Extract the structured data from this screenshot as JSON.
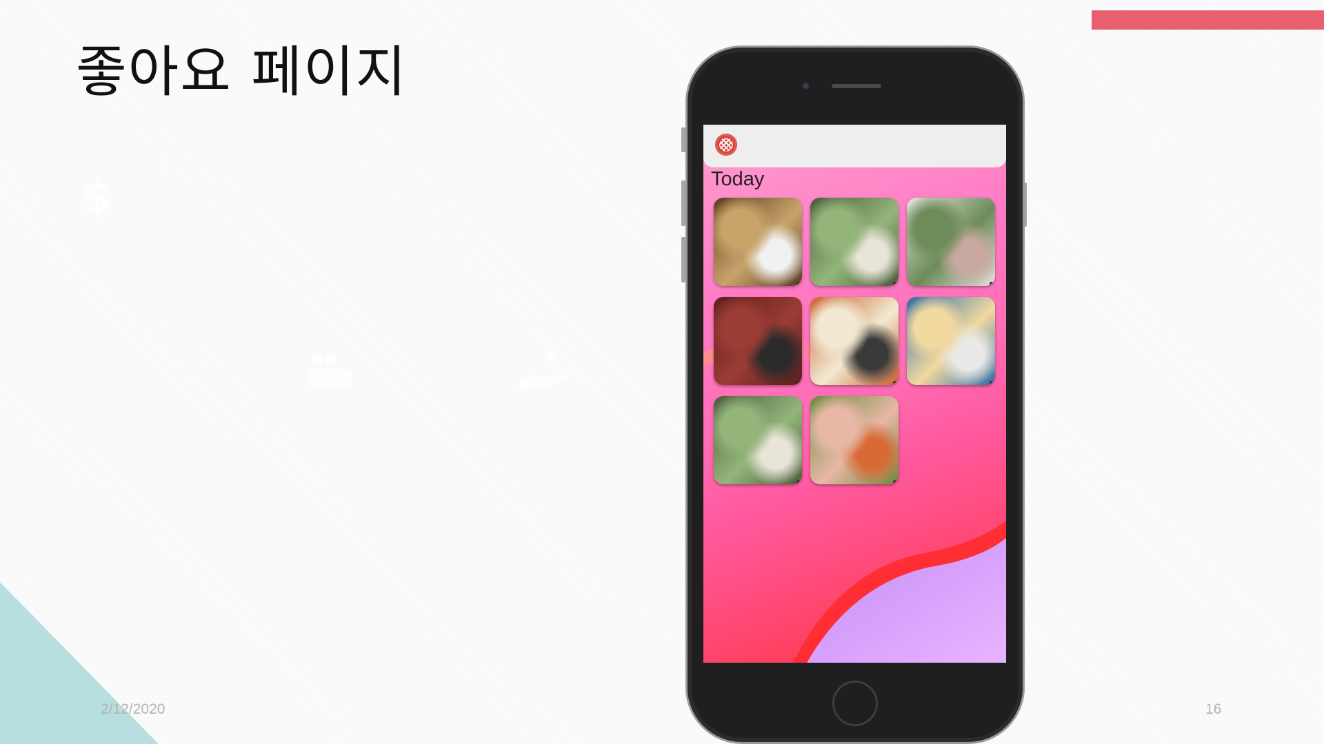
{
  "slide": {
    "title": "좋아요 페이지",
    "date": "2/12/2020",
    "page_number": "16"
  },
  "colors": {
    "accent": "#e8606f",
    "corner": "#b8dfe0"
  },
  "icons": [
    "dollar-icon",
    "people-icon",
    "hand-care-icon",
    "app-logo-icon"
  ],
  "app": {
    "section_title": "Today",
    "photos": [
      {
        "name": "photo-person-selfie",
        "colors": [
          "#5a3a20",
          "#c8a46a",
          "#f1f1f1"
        ]
      },
      {
        "name": "photo-soup-greens",
        "colors": [
          "#4b5a3a",
          "#93b57a",
          "#e8e4d8"
        ]
      },
      {
        "name": "photo-sashimi",
        "colors": [
          "#e6e2dc",
          "#6d8c5a",
          "#c9a8a0"
        ]
      },
      {
        "name": "photo-grilled-beef",
        "colors": [
          "#5a1f1c",
          "#9b3c35",
          "#2a2a2a"
        ]
      },
      {
        "name": "photo-spicy-dishes",
        "colors": [
          "#c9602c",
          "#f2e9d2",
          "#3a3a3a"
        ]
      },
      {
        "name": "photo-menu-board",
        "colors": [
          "#2a6aa8",
          "#f1d9a0",
          "#e9e9e9"
        ]
      },
      {
        "name": "photo-soup-greens-2",
        "colors": [
          "#4b5a3a",
          "#93b57a",
          "#e8e4d8"
        ]
      },
      {
        "name": "photo-salad-platter",
        "colors": [
          "#6a8a3c",
          "#e7b8a5",
          "#d86a35"
        ]
      }
    ]
  }
}
